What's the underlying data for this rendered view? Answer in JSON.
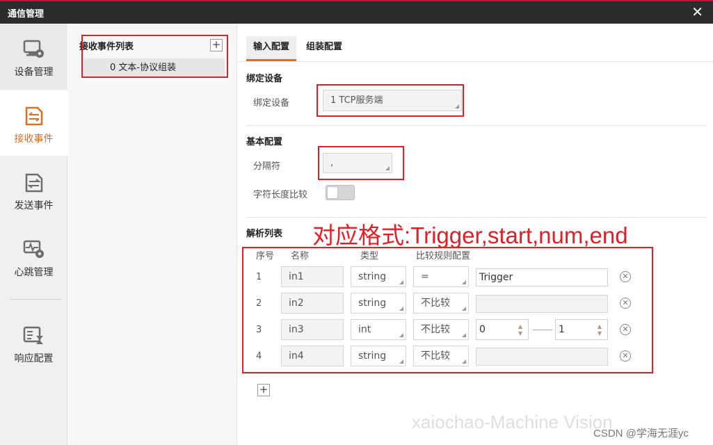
{
  "window": {
    "title": "通信管理",
    "close": "✕"
  },
  "nav": {
    "items": [
      {
        "label": "设备管理",
        "icon": "device-manage-icon"
      },
      {
        "label": "接收事件",
        "icon": "receive-event-icon"
      },
      {
        "label": "发送事件",
        "icon": "send-event-icon"
      },
      {
        "label": "心跳管理",
        "icon": "heartbeat-icon"
      },
      {
        "label": "响应配置",
        "icon": "response-config-icon"
      }
    ],
    "active_index": 1
  },
  "events": {
    "header": "接收事件列表",
    "add_label": "+",
    "items": [
      {
        "label": "0 文本-协议组装"
      }
    ]
  },
  "tabs": [
    {
      "label": "输入配置",
      "active": true
    },
    {
      "label": "组装配置",
      "active": false
    }
  ],
  "bind_device": {
    "section": "绑定设备",
    "label": "绑定设备",
    "value": "1 TCP服务端"
  },
  "basic": {
    "section": "基本配置",
    "separator_label": "分隔符",
    "separator_value": ",",
    "length_compare_label": "字符长度比较",
    "length_compare_on": false
  },
  "parse": {
    "section": "解析列表",
    "columns": [
      "序号",
      "名称",
      "类型",
      "比较规则配置"
    ],
    "rows": [
      {
        "index": "1",
        "name": "in1",
        "type": "string",
        "rule": "=",
        "value": "Trigger"
      },
      {
        "index": "2",
        "name": "in2",
        "type": "string",
        "rule": "不比较",
        "value": ""
      },
      {
        "index": "3",
        "name": "in3",
        "type": "int",
        "rule": "不比较",
        "min": "0",
        "max": "1"
      },
      {
        "index": "4",
        "name": "in4",
        "type": "string",
        "rule": "不比较",
        "value": ""
      }
    ],
    "add_label": "+",
    "delete_glyph": "✕"
  },
  "annotation": "对应格式:Trigger,start,num,end",
  "watermark": "xaiochao-Machine Vision",
  "credit": "CSDN @学海无涯yc",
  "colors": {
    "accent": "#e46c1f",
    "highlight": "#e21f26",
    "titlebar": "#2b2b2b"
  }
}
